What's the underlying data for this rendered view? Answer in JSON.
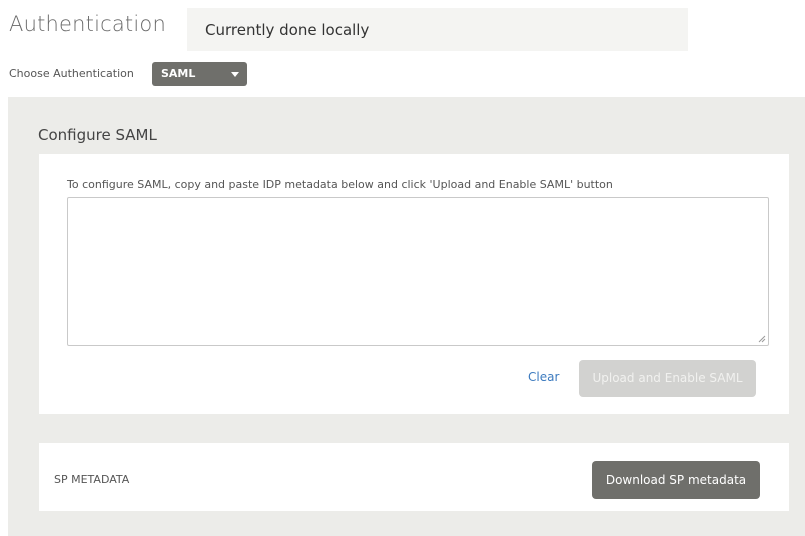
{
  "header": {
    "title": "Authentication",
    "status": "Currently done locally"
  },
  "auth_selector": {
    "label": "Choose Authentication",
    "selected": "SAML",
    "caret_icon": "caret-down-icon"
  },
  "saml": {
    "title": "Configure SAML",
    "instructions": "To configure SAML, copy and paste IDP metadata below and click 'Upload and Enable SAML' button",
    "metadata_value": "",
    "clear_label": "Clear",
    "upload_label": "Upload and Enable SAML",
    "upload_enabled": false
  },
  "sp_metadata": {
    "label": "SP METADATA",
    "download_label": "Download SP metadata"
  },
  "colors": {
    "dark_button": "#6f6f6b",
    "panel_background": "#ecece9",
    "link": "#3d7bbf",
    "disabled_button": "#d2d2d0"
  }
}
